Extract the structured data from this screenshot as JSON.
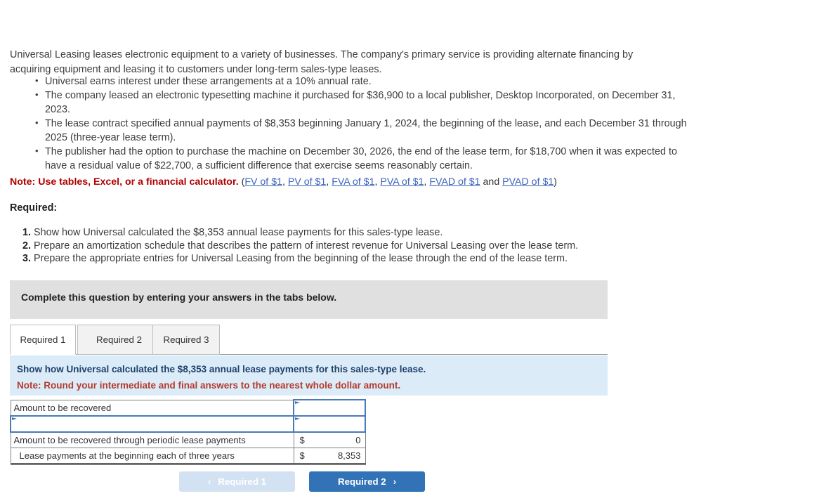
{
  "intro": {
    "paragraph": "Universal Leasing leases electronic equipment to a variety of businesses. The company's primary service is providing alternate financing by acquiring equipment and leasing it to customers under long-term sales-type leases."
  },
  "facts": [
    "Universal earns interest under these arrangements at a 10% annual rate.",
    "The company leased an electronic typesetting machine it purchased for $36,900 to a local publisher, Desktop Incorporated, on December 31, 2023.",
    "The lease contract specified annual payments of $8,353 beginning January 1, 2024, the beginning of the lease, and each December 31 through 2025 (three-year lease term).",
    "The publisher had the option to purchase the machine on December 30, 2026, the end of the lease term, for $18,700 when it was expected to have a residual value of $22,700, a sufficient difference that exercise seems reasonably certain."
  ],
  "note": {
    "label": "Note: Use tables, Excel, or a financial calculator.",
    "open_paren": "(",
    "links": [
      "FV of $1",
      "PV of $1",
      "FVA of $1",
      "PVA of $1",
      "FVAD of $1",
      "PVAD of $1"
    ],
    "separator": ", ",
    "conjunction": " and ",
    "close_paren": ")"
  },
  "required": {
    "heading": "Required:",
    "items": [
      {
        "num": "1.",
        "text": "Show how Universal calculated the $8,353 annual lease payments for this sales-type lease."
      },
      {
        "num": "2.",
        "text": "Prepare an amortization schedule that describes the pattern of interest revenue for Universal Leasing over the lease term."
      },
      {
        "num": "3.",
        "text": "Prepare the appropriate entries for Universal Leasing from the beginning of the lease through the end of the lease term."
      }
    ]
  },
  "banner": {
    "text": "Complete this question by entering your answers in the tabs below."
  },
  "tabs": [
    {
      "label": "Required 1",
      "active": true
    },
    {
      "label": "Required 2",
      "active": false
    },
    {
      "label": "Required 3",
      "active": false
    }
  ],
  "prompt": {
    "line1": "Show how Universal calculated the $8,353 annual lease payments for this sales-type lease.",
    "line2": "Note: Round your intermediate and final answers to the nearest whole dollar amount."
  },
  "answer_table": {
    "rows": [
      {
        "label": "Amount to be recovered",
        "label_editable": false,
        "indented": false,
        "value_editable": true,
        "dollar": "",
        "amount": "",
        "double_bottom": false
      },
      {
        "label": "",
        "label_editable": true,
        "indented": false,
        "value_editable": true,
        "dollar": "",
        "amount": "",
        "double_bottom": false
      },
      {
        "label": "Amount to be recovered through periodic lease payments",
        "label_editable": false,
        "indented": false,
        "value_editable": false,
        "dollar": "$",
        "amount": "0",
        "double_bottom": false
      },
      {
        "label": "Lease payments at the beginning each of three years",
        "label_editable": false,
        "indented": true,
        "value_editable": false,
        "dollar": "$",
        "amount": "8,353",
        "double_bottom": true
      }
    ]
  },
  "nav": {
    "prev_label": "Required 1",
    "next_label": "Required 2",
    "prev_chevron": "‹",
    "next_chevron": "›"
  },
  "colors": {
    "accent_blue": "#3272b6",
    "prev_button": "#d3e2f2",
    "panel_blue": "#dbecf8",
    "banner_grey": "#e0e0e0",
    "link_blue": "#3b63bd",
    "note_red": "#b00000",
    "prompt_red": "#b53a2e",
    "cell_border_blue": "#4a79b8"
  }
}
